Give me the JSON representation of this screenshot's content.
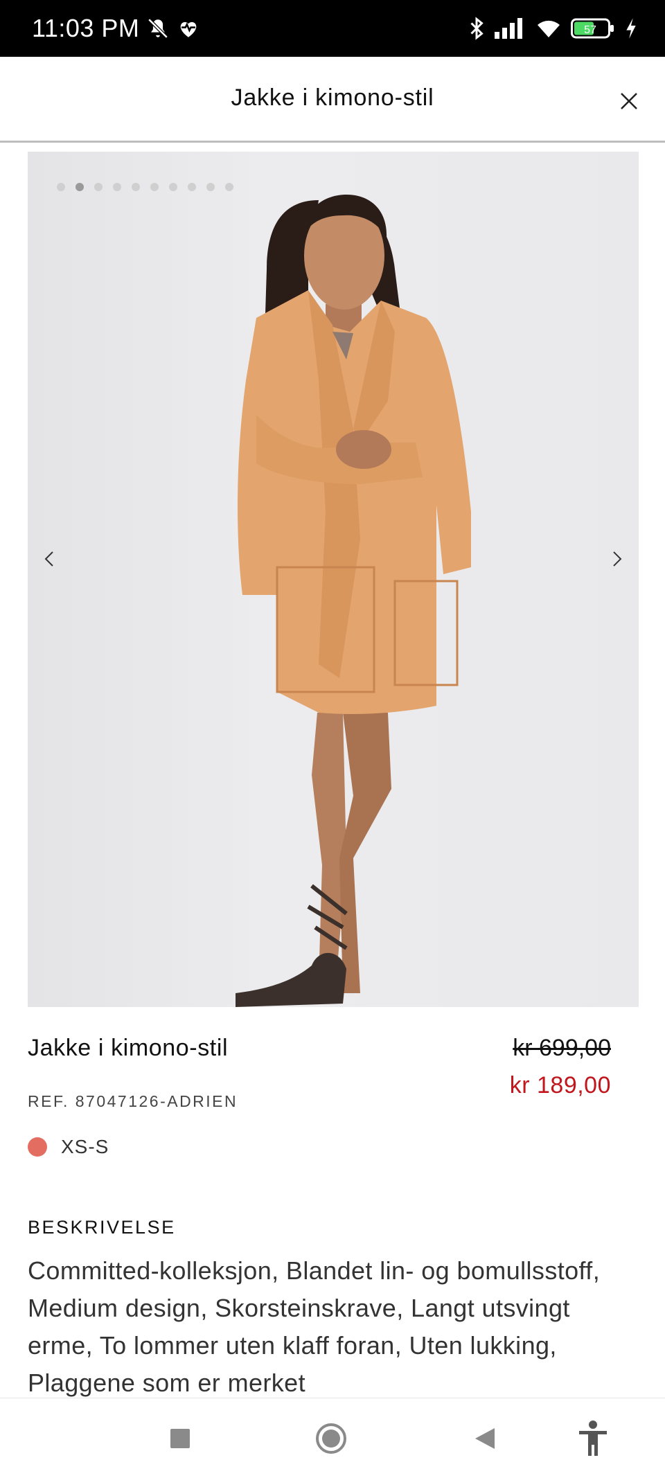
{
  "status_bar": {
    "time": "11:03 PM",
    "battery_level": "57",
    "icons": [
      "bell-off-icon",
      "heart-pulse-icon",
      "bluetooth-icon",
      "signal-icon",
      "wifi-icon",
      "battery-icon",
      "charging-icon"
    ]
  },
  "header": {
    "title": "Jakke i kimono-stil",
    "close_icon": "close-icon"
  },
  "gallery": {
    "image_count": 10,
    "active_index": 1,
    "prev_icon": "chevron-left-icon",
    "next_icon": "chevron-right-icon"
  },
  "product": {
    "title": "Jakke i kimono-stil",
    "old_price": "kr 699,00",
    "new_price": "kr 189,00",
    "ref": "REF. 87047126-ADRIEN",
    "size": "XS-S"
  },
  "description": {
    "heading": "BESKRIVELSE",
    "body": "Committed-kolleksjon, Blandet lin- og bomullsstoff, Medium design, Skorsteinskrave, Langt utsvingt erme, To lommer uten klaff foran, Uten lukking, Plaggene som er merket"
  },
  "colors": {
    "price_sale": "#c0161c",
    "swatch": "#e46d62",
    "garment": "#e3a46e"
  },
  "nav_bar": {
    "icons": [
      "recents-square-icon",
      "home-circle-icon",
      "back-triangle-icon",
      "accessibility-icon"
    ]
  }
}
